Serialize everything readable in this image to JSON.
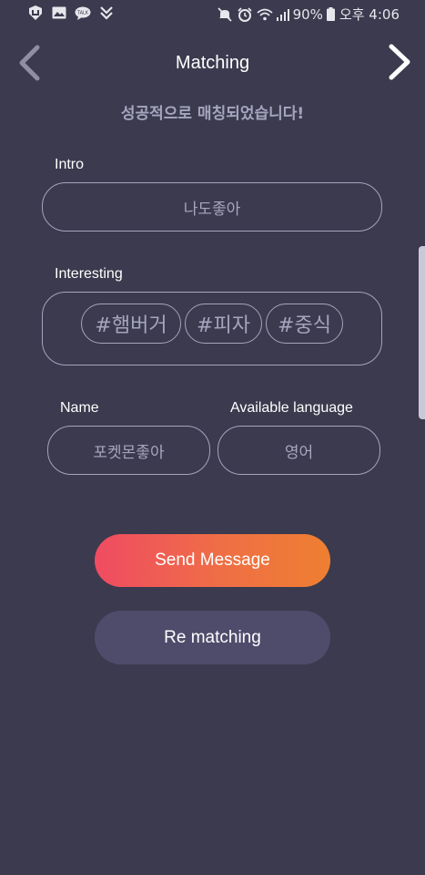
{
  "status_bar": {
    "battery": "90%",
    "time": "오후 4:06",
    "left_icons": [
      "app-notification-icon",
      "image-icon",
      "talk-icon",
      "checklist-icon"
    ],
    "right_icons": [
      "mute-icon",
      "alarm-icon",
      "wifi-icon",
      "signal-icon",
      "battery-icon"
    ]
  },
  "header": {
    "title": "Matching",
    "back_icon": "chevron-left-icon",
    "next_icon": "chevron-right-icon"
  },
  "success_message": "성공적으로 매칭되었습니다!",
  "intro": {
    "label": "Intro",
    "value": "나도좋아"
  },
  "interesting": {
    "label": "Interesting",
    "tags": [
      "#햄버거",
      "#피자",
      "#중식"
    ]
  },
  "name": {
    "label": "Name",
    "value": "포켓몬좋아"
  },
  "language": {
    "label": "Available language",
    "value": "영어"
  },
  "buttons": {
    "send_message": "Send Message",
    "re_matching": "Re matching"
  },
  "colors": {
    "background": "#3b3a4e",
    "accent_start": "#ef4b62",
    "accent_end": "#ee7f31",
    "secondary_button": "#4f4b6b",
    "muted_text": "#a6a5bd"
  }
}
